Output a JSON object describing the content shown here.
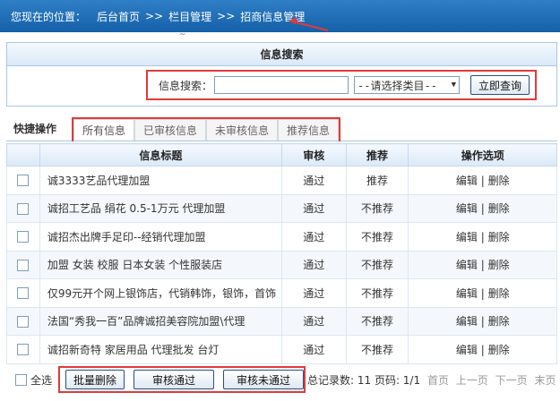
{
  "location": {
    "prefix": "您现在的位置：",
    "crumbs": [
      "后台首页",
      "栏目管理",
      "招商信息管理"
    ],
    "separator": ">>"
  },
  "search": {
    "title": "信息搜索",
    "label": "信息搜索：",
    "input_value": "",
    "category_selected": "--请选择类目--",
    "submit_label": "立即查询"
  },
  "tabs": {
    "label": "快捷操作",
    "items": [
      "所有信息",
      "已审核信息",
      "未审核信息",
      "推荐信息"
    ]
  },
  "table": {
    "headers": [
      "信息标题",
      "审核",
      "推荐",
      "操作选项"
    ],
    "rows": [
      {
        "title": "诚3333艺品代理加盟",
        "review": "通过",
        "recommend": "推荐"
      },
      {
        "title": "诚招工艺品 绢花 0.5-1万元 代理加盟",
        "review": "通过",
        "recommend": "不推荐"
      },
      {
        "title": "诚招杰出牌手足印--经销代理加盟",
        "review": "通过",
        "recommend": "不推荐"
      },
      {
        "title": "加盟  女装  校服 日本女装 个性服装店",
        "review": "通过",
        "recommend": "不推荐"
      },
      {
        "title": "仅99元开个网上银饰店，代销韩饰，银饰，首饰",
        "review": "通过",
        "recommend": "不推荐"
      },
      {
        "title": "法国“秀我一百”品牌诚招美容院加盟\\代理",
        "review": "通过",
        "recommend": "不推荐"
      },
      {
        "title": "诚招新奇特 家居用品 代理批发 台灯",
        "review": "通过",
        "recommend": "不推荐"
      }
    ],
    "edit_label": "编辑",
    "action_sep": "|",
    "delete_label": "删除"
  },
  "footer": {
    "select_all": "全选",
    "bulk_delete": "批量删除",
    "approve": "审核通过",
    "reject": "审核未通过",
    "pager_info": "总记录数: 11 页码: 1/1",
    "first": "首页",
    "prev": "上一页",
    "next": "下一页",
    "last": "末页"
  },
  "colors": {
    "header_blue": "#1e6bb5",
    "annotation_red": "#e23a3a",
    "border_blue": "#a9c6e6"
  }
}
